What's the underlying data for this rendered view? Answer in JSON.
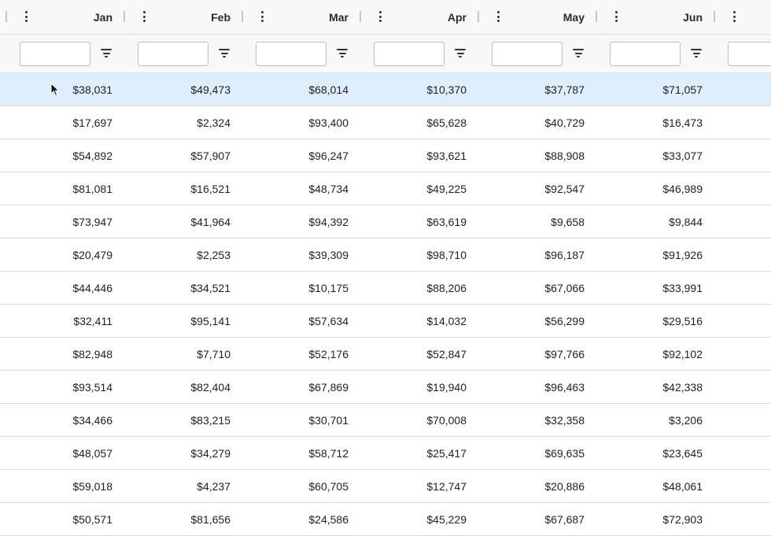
{
  "columns": [
    "Jan",
    "Feb",
    "Mar",
    "Apr",
    "May",
    "Jun"
  ],
  "filters": [
    "",
    "",
    "",
    "",
    "",
    "",
    ""
  ],
  "rows": [
    [
      "$38,031",
      "$49,473",
      "$68,014",
      "$10,370",
      "$37,787",
      "$71,057"
    ],
    [
      "$17,697",
      "$2,324",
      "$93,400",
      "$65,628",
      "$40,729",
      "$16,473"
    ],
    [
      "$54,892",
      "$57,907",
      "$96,247",
      "$93,621",
      "$88,908",
      "$33,077"
    ],
    [
      "$81,081",
      "$16,521",
      "$48,734",
      "$49,225",
      "$92,547",
      "$46,989"
    ],
    [
      "$73,947",
      "$41,964",
      "$94,392",
      "$63,619",
      "$9,658",
      "$9,844"
    ],
    [
      "$20,479",
      "$2,253",
      "$39,309",
      "$98,710",
      "$96,187",
      "$91,926"
    ],
    [
      "$44,446",
      "$34,521",
      "$10,175",
      "$88,206",
      "$67,066",
      "$33,991"
    ],
    [
      "$32,411",
      "$95,141",
      "$57,634",
      "$14,032",
      "$56,299",
      "$29,516"
    ],
    [
      "$82,948",
      "$7,710",
      "$52,176",
      "$52,847",
      "$97,766",
      "$92,102"
    ],
    [
      "$93,514",
      "$82,404",
      "$67,869",
      "$19,940",
      "$96,463",
      "$42,338"
    ],
    [
      "$34,466",
      "$83,215",
      "$30,701",
      "$70,008",
      "$32,358",
      "$3,206"
    ],
    [
      "$48,057",
      "$34,279",
      "$58,712",
      "$25,417",
      "$69,635",
      "$23,645"
    ],
    [
      "$59,018",
      "$4,237",
      "$60,705",
      "$12,747",
      "$20,886",
      "$48,061"
    ],
    [
      "$50,571",
      "$81,656",
      "$24,586",
      "$45,229",
      "$67,687",
      "$72,903"
    ]
  ],
  "selected_row": 0,
  "colors": {
    "header_bg": "#f8f8f8",
    "selected_row_bg": "#dfeefd",
    "border": "#dadada"
  }
}
